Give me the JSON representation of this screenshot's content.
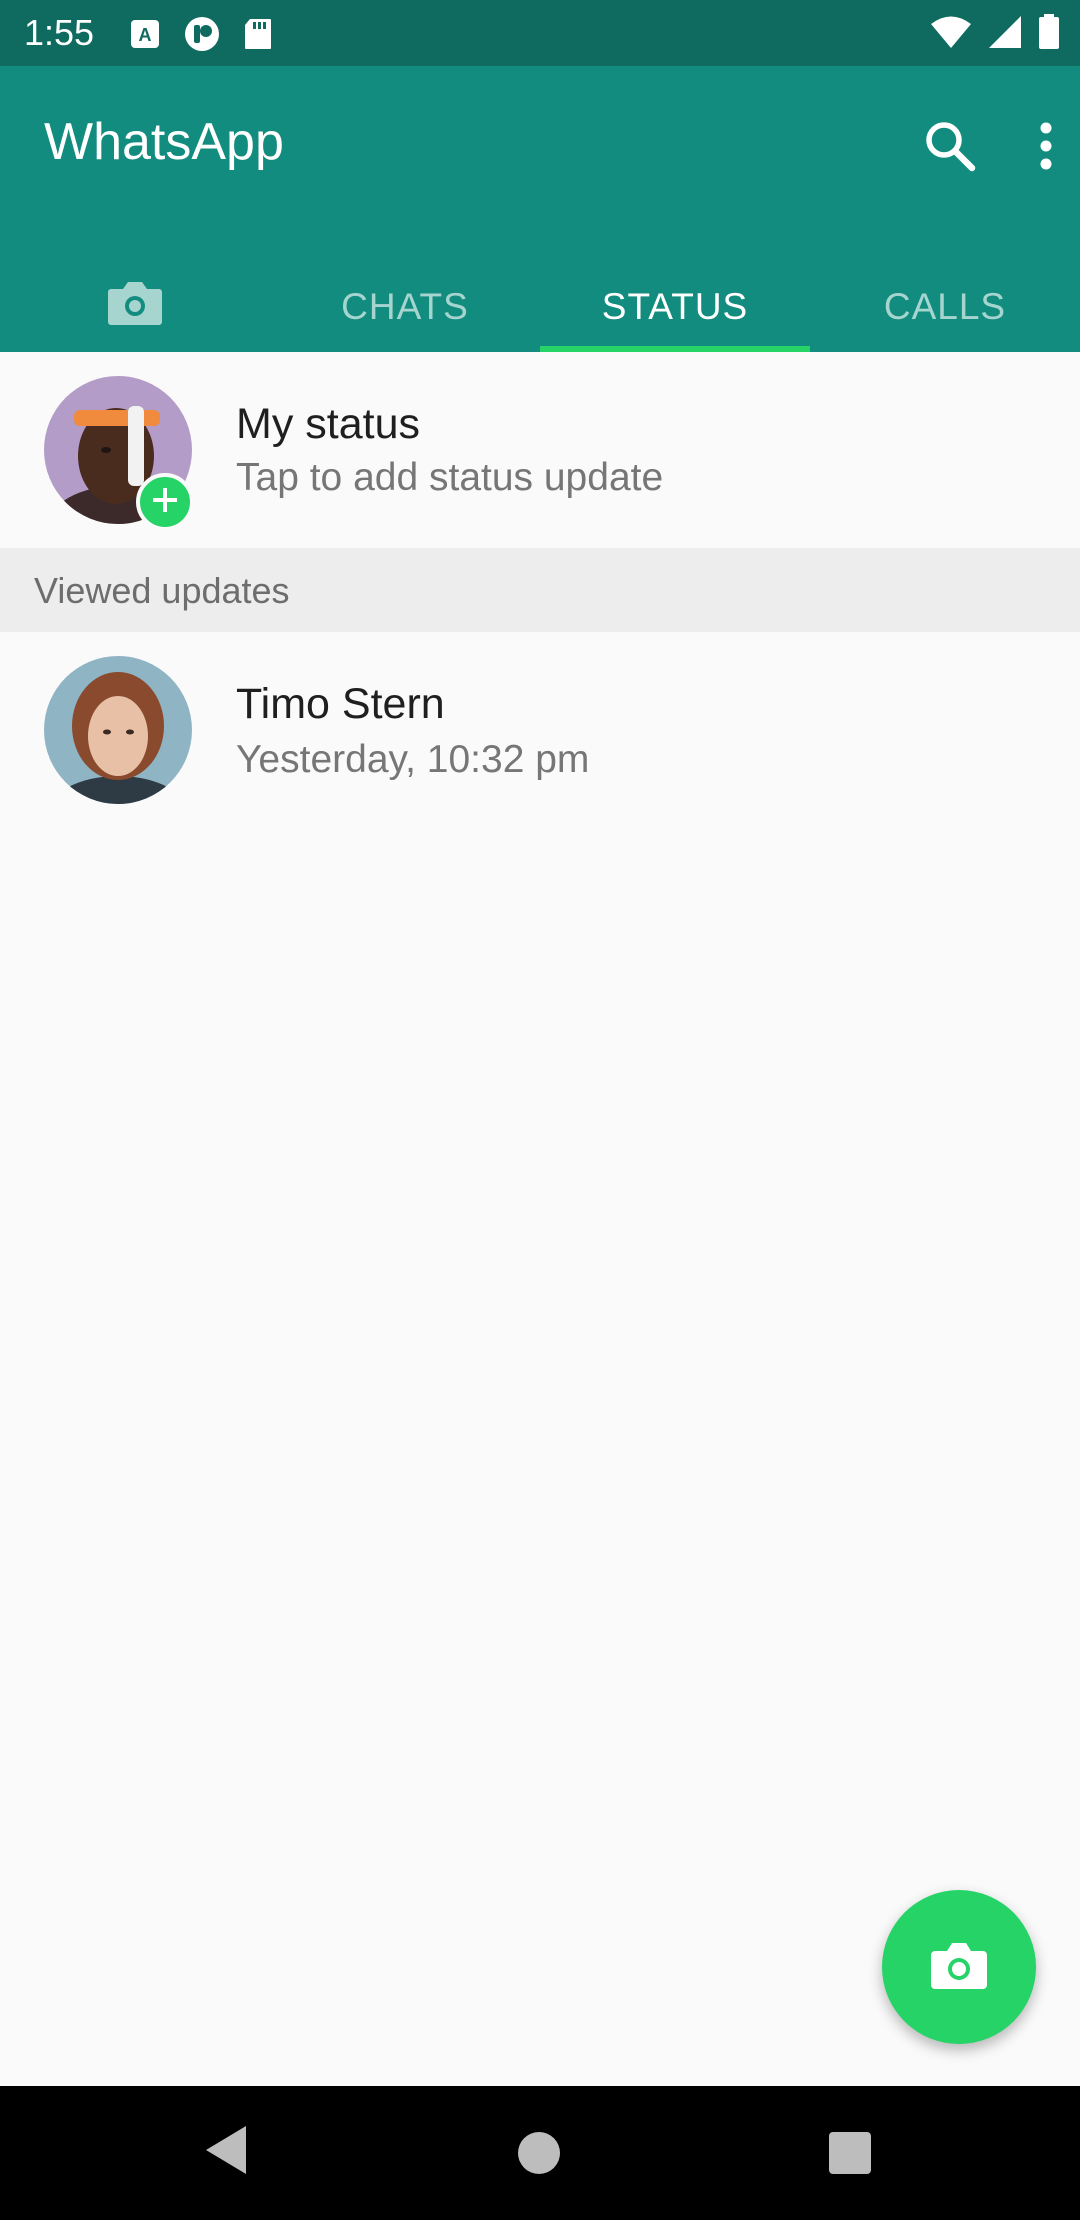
{
  "status_bar": {
    "time": "1:55",
    "left_icons": [
      "app-a-icon",
      "app-k-icon",
      "sd-card-icon"
    ],
    "right_icons": [
      "wifi-icon",
      "signal-icon",
      "battery-icon"
    ]
  },
  "app_bar": {
    "title": "WhatsApp",
    "actions": [
      "search-icon",
      "more-vert-icon"
    ]
  },
  "tabs": {
    "camera_icon": "camera-icon",
    "chats": "CHATS",
    "status": "STATUS",
    "calls": "CALLS",
    "active": "STATUS"
  },
  "my_status": {
    "title": "My status",
    "subtitle": "Tap to add status update"
  },
  "sections": {
    "viewed": "Viewed updates"
  },
  "contacts": [
    {
      "name": "Timo Stern",
      "time": "Yesterday, 10:32 pm"
    }
  ],
  "fab": {
    "icon": "camera-icon"
  },
  "colors": {
    "status_bar": "#0f6b60",
    "app_bar": "#128c7e",
    "accent": "#25d366",
    "tab_inactive": "#a6d5cf"
  }
}
